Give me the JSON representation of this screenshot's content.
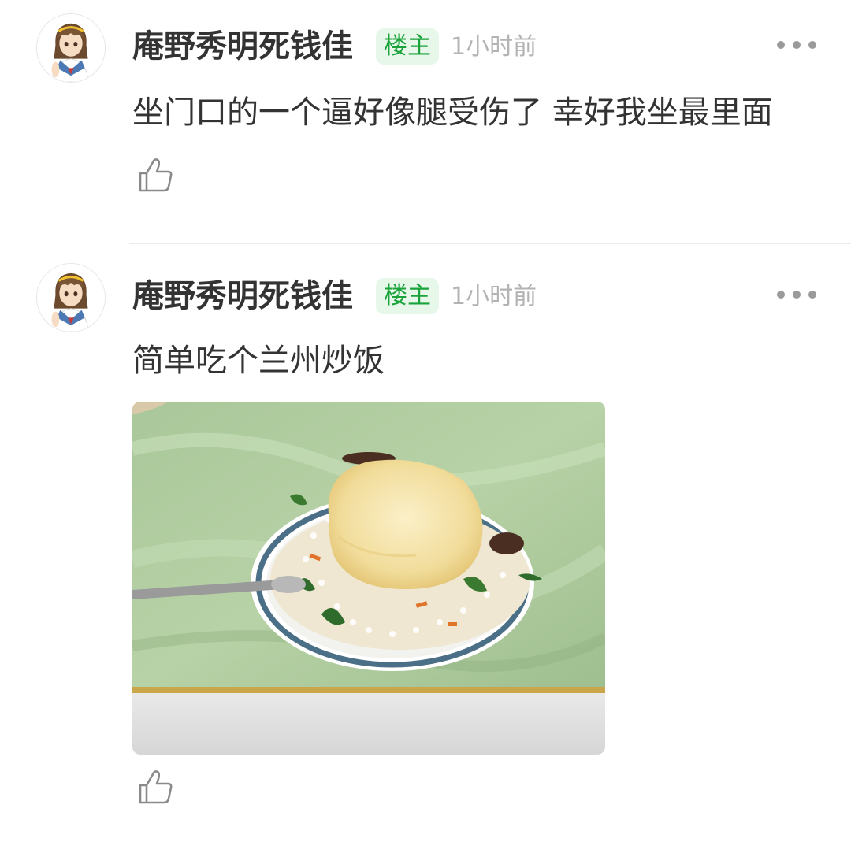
{
  "posts": [
    {
      "username": "庵野秀明死钱佳",
      "badge": "楼主",
      "time": "1小时前",
      "content": "坐门口的一个逼好像腿受伤了 幸好我坐最里面"
    },
    {
      "username": "庵野秀明死钱佳",
      "badge": "楼主",
      "time": "1小时前",
      "content": "简单吃个兰州炒饭",
      "image": "photo of fried rice with a fried egg on a blue-rimmed plate on a green marble table"
    }
  ],
  "icons": {
    "more": "more-dots-icon",
    "like": "thumbs-up-icon",
    "avatar": "anime-girl-avatar"
  },
  "colors": {
    "badge_bg": "#e7f7ea",
    "badge_text": "#1aa33a",
    "timestamp": "#b3b3b3",
    "text": "#333333"
  }
}
